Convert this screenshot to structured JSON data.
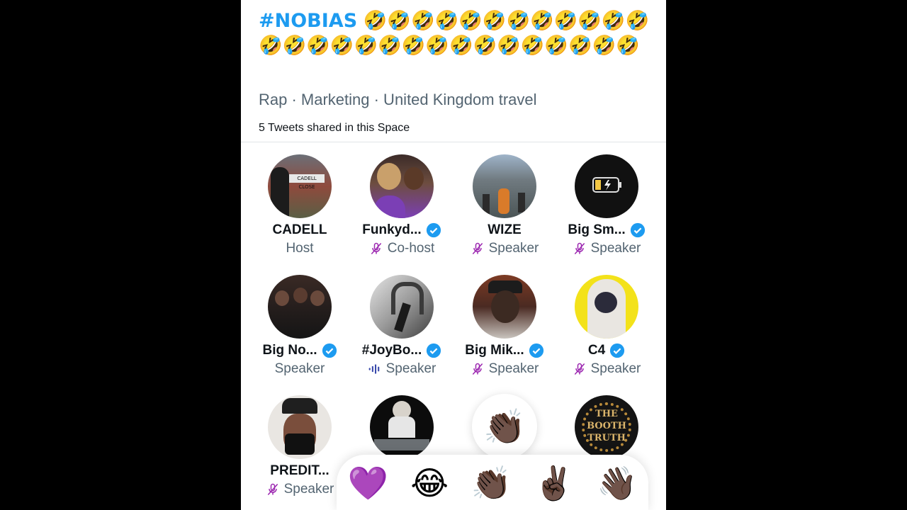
{
  "space": {
    "hashtag": "#NOBIAS",
    "emoji_run": "🤣🤣🤣🤣🤣🤣🤣🤣🤣🤣🤣🤣🤣🤣🤣🤣🤣🤣🤣🤣🤣🤣🤣🤣🤣🤣🤣🤣",
    "topics": "Rap · Marketing · United Kingdom travel",
    "tweets_shared": "5 Tweets shared in this Space"
  },
  "participants": [
    {
      "name": "CADELL",
      "role": "Host",
      "verified": false,
      "mic": "none"
    },
    {
      "name": "Funkyd...",
      "role": "Co-host",
      "verified": true,
      "mic": "muted"
    },
    {
      "name": "WIZE",
      "role": "Speaker",
      "verified": false,
      "mic": "muted"
    },
    {
      "name": "Big Sm...",
      "role": "Speaker",
      "verified": true,
      "mic": "muted"
    },
    {
      "name": "Big No...",
      "role": "Speaker",
      "verified": true,
      "mic": "none"
    },
    {
      "name": "#JoyBo...",
      "role": "Speaker",
      "verified": true,
      "mic": "speaking"
    },
    {
      "name": "Big Mik...",
      "role": "Speaker",
      "verified": true,
      "mic": "muted"
    },
    {
      "name": "C4",
      "role": "Speaker",
      "verified": true,
      "mic": "muted"
    },
    {
      "name": "PREDIT...",
      "role": "Speaker",
      "verified": false,
      "mic": "muted"
    }
  ],
  "reactions": {
    "heart": "💜",
    "laugh": "😂",
    "clap": "👏🏿",
    "peace": "✌🏿",
    "wave": "👋🏿"
  },
  "colors": {
    "accent": "#1d9bf0",
    "muted_mic": "#9c27b0",
    "speaking": "#3949ab"
  }
}
